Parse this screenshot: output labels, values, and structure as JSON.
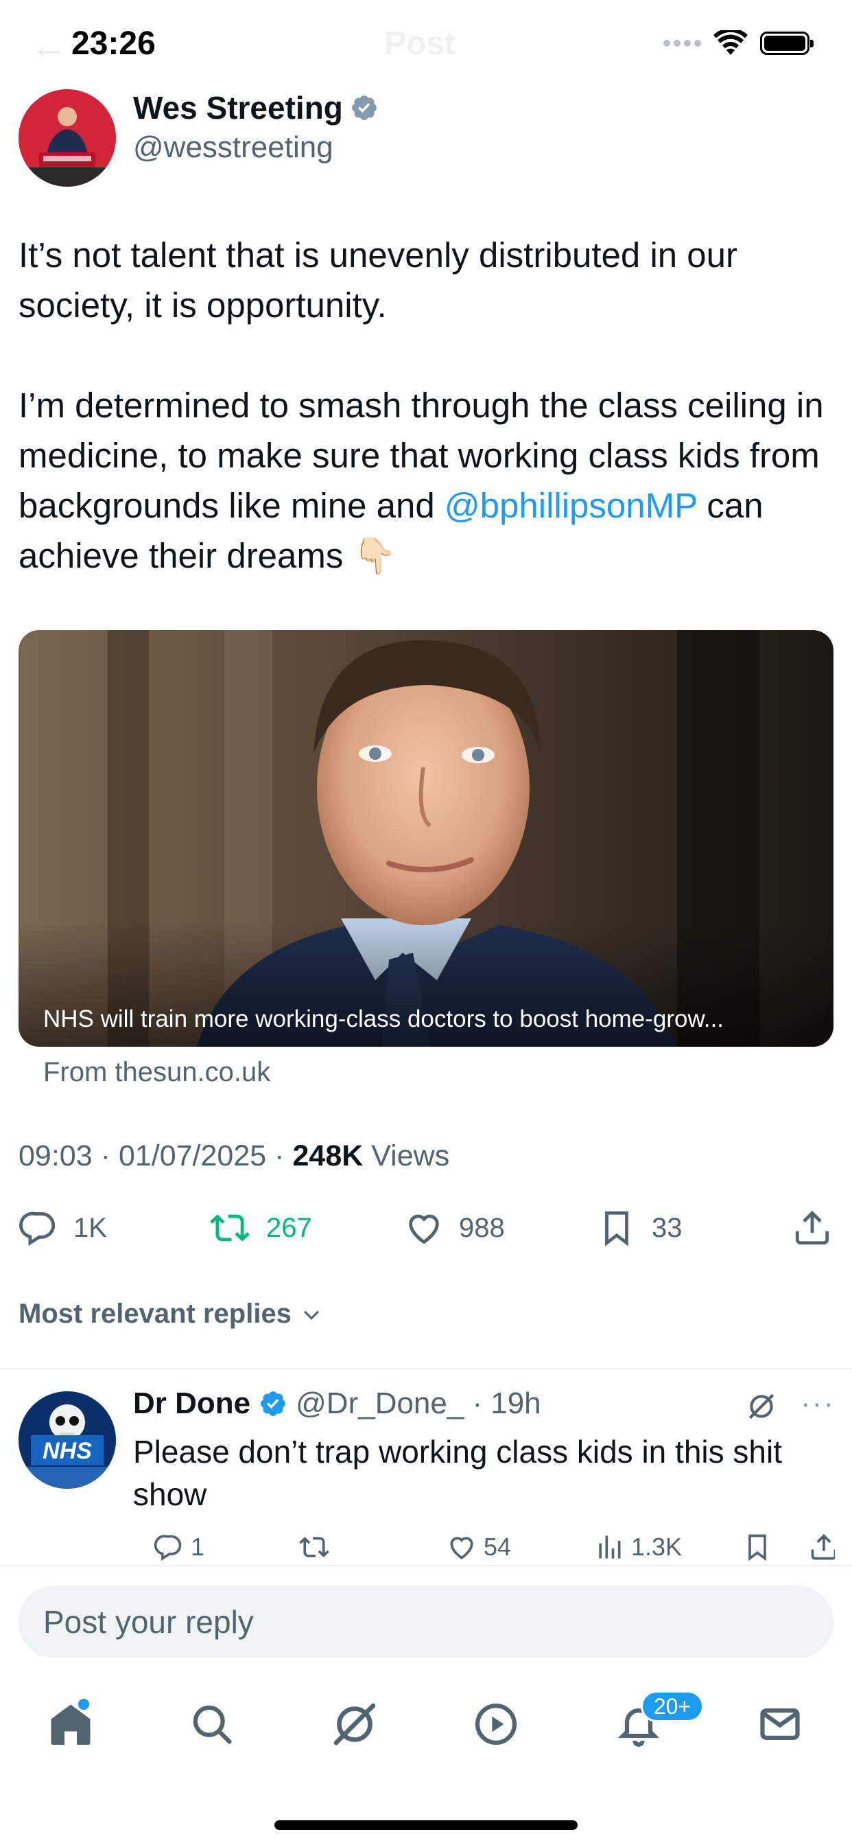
{
  "status_bar": {
    "time": "23:26"
  },
  "header": {
    "title": "Post"
  },
  "post": {
    "author_name": "Wes Streeting",
    "author_handle": "@wesstreeting",
    "text_part1": "It’s not talent that is unevenly distributed in our society, it is opportunity.\n\nI’m determined to smash through the class ceiling in medicine, to make sure that working class kids from backgrounds like mine and ",
    "mention": "@bphillipsonMP",
    "text_part2": " can achieve their dreams ",
    "emoji": "👇🏻",
    "card": {
      "caption": "NHS will train more working-class doctors to boost home-grow...",
      "source": "From thesun.co.uk"
    },
    "time": "09:03",
    "date": "01/07/2025",
    "views_count": "248K",
    "views_label": "Views",
    "sep": "·",
    "stats": {
      "replies": "1K",
      "reposts": "267",
      "likes": "988",
      "bookmarks": "33"
    }
  },
  "sort": {
    "label": "Most relevant replies"
  },
  "reply": {
    "name": "Dr Done",
    "handle": "@Dr_Done_",
    "age": "· 19h",
    "text": "Please don’t trap working class kids in this shit show",
    "avatar_text": "NHS",
    "more": "···",
    "stats": {
      "replies": "1",
      "likes": "54",
      "views": "1.3K"
    }
  },
  "composer": {
    "placeholder": "Post your reply"
  },
  "tabs": {
    "notifications_badge": "20+"
  },
  "colors": {
    "accent": "#1d9bf0",
    "repost": "#00ba7c",
    "muted": "#536471",
    "text": "#0f1419"
  },
  "icons": [
    "verified-badge-icon",
    "reply-icon",
    "repost-icon",
    "like-icon",
    "bookmark-icon",
    "share-icon",
    "grok-icon",
    "views-icon",
    "home-icon",
    "search-icon",
    "play-icon",
    "bell-icon",
    "mail-icon"
  ]
}
